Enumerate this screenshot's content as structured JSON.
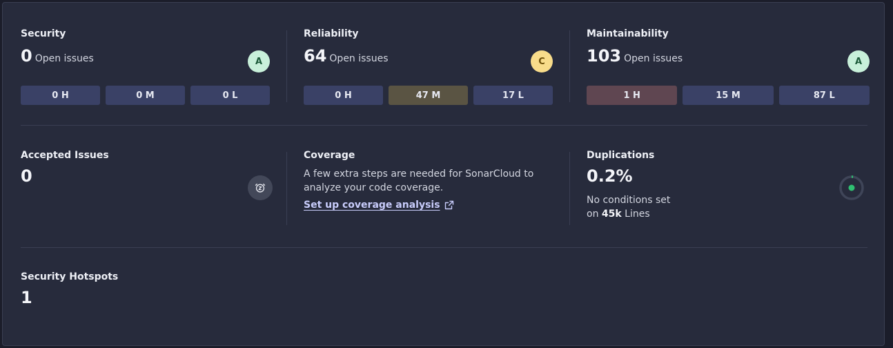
{
  "security": {
    "title": "Security",
    "count": "0",
    "count_label": "Open issues",
    "grade": "A",
    "pills": [
      "0 H",
      "0 M",
      "0 L"
    ]
  },
  "reliability": {
    "title": "Reliability",
    "count": "64",
    "count_label": "Open issues",
    "grade": "C",
    "pills": [
      "0 H",
      "47 M",
      "17 L"
    ]
  },
  "maintainability": {
    "title": "Maintainability",
    "count": "103",
    "count_label": "Open issues",
    "grade": "A",
    "pills": [
      "1 H",
      "15 M",
      "87 L"
    ]
  },
  "accepted": {
    "title": "Accepted Issues",
    "count": "0",
    "icon": "snooze-clock-icon"
  },
  "coverage": {
    "title": "Coverage",
    "description": "A few extra steps are needed for SonarCloud to analyze your code coverage.",
    "link": "Set up coverage analysis",
    "link_icon": "external-link-icon"
  },
  "duplications": {
    "title": "Duplications",
    "value": "0.2%",
    "note_line1": "No conditions set",
    "note_prefix": "on",
    "lines_count": "45k",
    "lines_label": "Lines",
    "ratio": 0.002
  },
  "hotspots": {
    "title": "Security Hotspots",
    "count": "1"
  },
  "colors": {
    "panel": "#272b3c",
    "grade_a": "#c8f0da",
    "grade_c": "#f8dc8a",
    "pill_default": "#3a4166",
    "pill_medium": "#5a5443",
    "pill_high": "#5f4651",
    "duplication_green": "#2fbf71"
  }
}
